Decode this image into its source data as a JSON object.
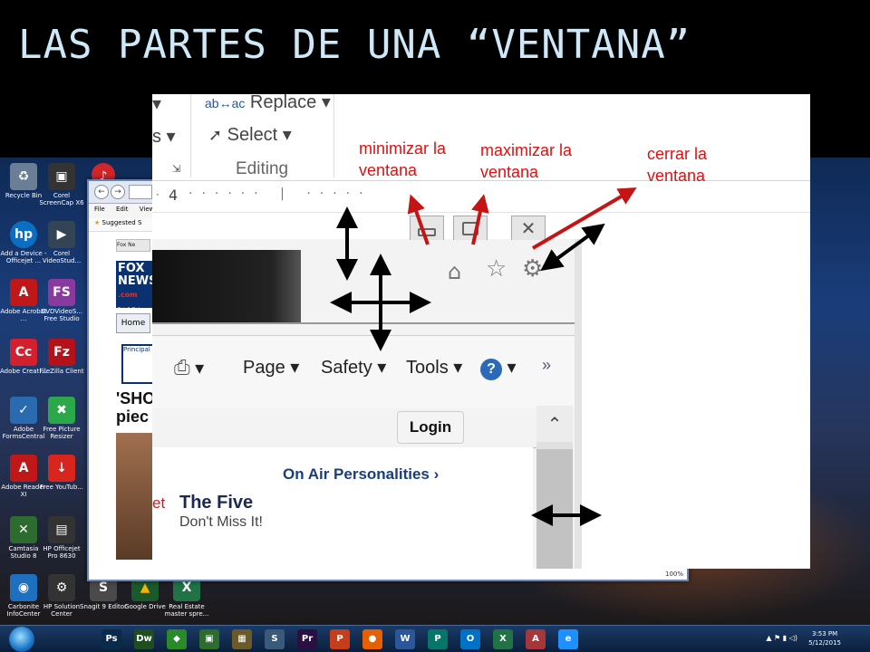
{
  "slide": {
    "title": "LAS PARTES DE UNA “VENTANA”"
  },
  "desktop_icons": [
    {
      "label": "Recycle Bin",
      "glyph": "♻",
      "color": "#6a7f96"
    },
    {
      "label": "Corel ScreenCap X6",
      "glyph": "▣",
      "color": "#333333"
    },
    {
      "label": "Add a Device - Officejet ...",
      "glyph": "hp",
      "color": "#0a6fc2"
    },
    {
      "label": "Corel VideoStud...",
      "glyph": "▶",
      "color": "#334455"
    },
    {
      "label": "Adobe Acrobat ...",
      "glyph": "A",
      "color": "#c01818"
    },
    {
      "label": "DVDVideoS... Free Studio",
      "glyph": "FS",
      "color": "#8a3a9e"
    },
    {
      "label": "Adobe Creati...",
      "glyph": "Cc",
      "color": "#d2202f"
    },
    {
      "label": "FileZilla Client",
      "glyph": "Fz",
      "color": "#b3121a"
    },
    {
      "label": "Adobe FormsCentral",
      "glyph": "✓",
      "color": "#2a6ab0"
    },
    {
      "label": "Free Picture Resizer",
      "glyph": "✖",
      "color": "#2aa84a"
    },
    {
      "label": "Adobe Reader XI",
      "glyph": "A",
      "color": "#c01818"
    },
    {
      "label": "Free YouTub...",
      "glyph": "↓",
      "color": "#d8261f"
    },
    {
      "label": "Camtasia Studio 8",
      "glyph": "✕",
      "color": "#2e6b2e"
    },
    {
      "label": "HP Officejet Pro 8630",
      "glyph": "▤",
      "color": "#333333"
    },
    {
      "label": "Carbonite InfoCenter",
      "glyph": "◉",
      "color": "#1e6fc0"
    },
    {
      "label": "HP Solution Center",
      "glyph": "⚙",
      "color": "#333333"
    },
    {
      "label": "Snagit 9 Editor",
      "glyph": "S",
      "color": "#4a4a4a"
    },
    {
      "label": "Google Drive",
      "glyph": "▲",
      "color": "#f4b400"
    },
    {
      "label": "Real Estate master spre...",
      "glyph": "X",
      "color": "#217346"
    }
  ],
  "background_browser": {
    "menu": [
      "File",
      "Edit",
      "View"
    ],
    "favorites": "Suggested S",
    "tab": "Fox Ne",
    "logo_lines": [
      "FOX",
      "NEWS",
      ".com",
      "Fair & Balance"
    ],
    "nav_home": "Home",
    "principal": "Principal",
    "headline_lines": [
      "'SHO",
      "piec"
    ],
    "zoom": "100%"
  },
  "ribbon": {
    "replace_label": "Replace",
    "select_label": "Select",
    "editing_label": "Editing",
    "left_fragment": "s"
  },
  "ruler": {
    "number": "4"
  },
  "ie_window": {
    "commands": {
      "page": "Page",
      "safety": "Safety",
      "tools": "Tools",
      "more": "»"
    },
    "login_label": "Login",
    "on_air_label": "On Air Personalities ›",
    "show_title": "The Five",
    "show_subtitle": "Don't Miss It!",
    "edge_fragment": "et"
  },
  "annotations": {
    "minimize": "minimizar la ventana",
    "maximize": "maximizar la ventana",
    "close": "cerrar la ventana"
  },
  "taskbar": {
    "apps": [
      {
        "name": "photoshop-app",
        "glyph": "Ps",
        "color": "#0a2a4a"
      },
      {
        "name": "dreamweaver-app",
        "glyph": "Dw",
        "color": "#1f4d1f"
      },
      {
        "name": "dropbox-app",
        "glyph": "◆",
        "color": "#2a8a2a"
      },
      {
        "name": "camtasia-app",
        "glyph": "▣",
        "color": "#2e6b2e"
      },
      {
        "name": "windows-explorer-app",
        "glyph": "▦",
        "color": "#6a5a2a"
      },
      {
        "name": "snagit-app",
        "glyph": "S",
        "color": "#3a5a7a"
      },
      {
        "name": "premiere-app",
        "glyph": "Pr",
        "color": "#2a1040"
      },
      {
        "name": "powerpoint-app",
        "glyph": "P",
        "color": "#c43e1c"
      },
      {
        "name": "firefox-app",
        "glyph": "●",
        "color": "#e66000"
      },
      {
        "name": "word-app",
        "glyph": "W",
        "color": "#2b579a"
      },
      {
        "name": "publisher-app",
        "glyph": "P",
        "color": "#077568"
      },
      {
        "name": "outlook-app",
        "glyph": "O",
        "color": "#0072c6"
      },
      {
        "name": "excel-app",
        "glyph": "X",
        "color": "#217346"
      },
      {
        "name": "access-app",
        "glyph": "A",
        "color": "#a4373a"
      },
      {
        "name": "internet-explorer-app",
        "glyph": "e",
        "color": "#1e90ff"
      }
    ],
    "time": "3:53 PM",
    "date": "5/12/2015"
  }
}
